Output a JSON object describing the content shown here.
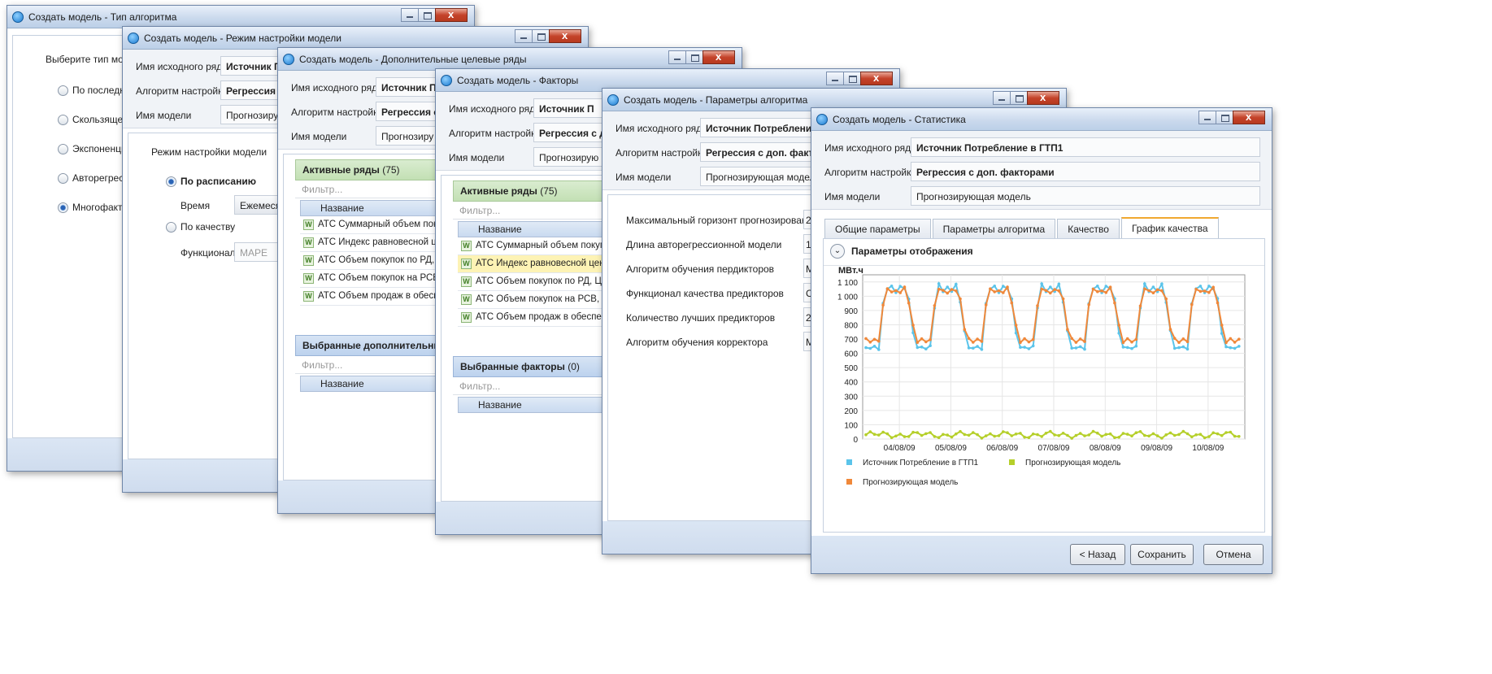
{
  "labels": {
    "source": "Имя исходного ряд",
    "algo": "Алгоритм настройк",
    "model": "Имя модели"
  },
  "values": {
    "source": "Источник Потребление в ГТП1",
    "algo": "Регрессия с доп. факторами",
    "model": "Прогнозирующая модель"
  },
  "win1": {
    "title": "Создать модель - Тип алгоритма",
    "prompt": "Выберите тип мо",
    "options": [
      "По последн",
      "Скользящее",
      "Экспоненци",
      "Авторегресс",
      "Многофакто"
    ],
    "selected": 4
  },
  "win2": {
    "title": "Создать модель - Режим настройки модели",
    "source_short": "Источник П",
    "algo_short": "Регрессия с",
    "model_short": "Прогнозиру",
    "section": "Режим настройки модели",
    "schedule": "По расписанию",
    "time_label": "Время",
    "time_value": "Ежемесяч",
    "quality": "По качеству",
    "func_label": "Функционал",
    "func_value": "MAPE"
  },
  "win3": {
    "title": "Создать модель - Дополнительные целевые ряды",
    "source_short": "Источник П",
    "algo_short": "Регрессия с",
    "model_short": "Прогнозиру",
    "active_header": "Активные ряды",
    "active_count": "(75)",
    "filter": "Фильтр...",
    "col_name": "Название",
    "rows": [
      "АТС Суммарный объем покуп",
      "АТС Индекс равновесной цен",
      "АТС Объем покупок по РД, Ц3",
      "АТС Объем покупок на РСВ, Ц3",
      "АТС Объем продаж в обеспеч"
    ],
    "selected_header": "Выбранные дополнительны"
  },
  "win4": {
    "title": "Создать модель - Факторы",
    "source_short": "Источник П",
    "algo_short": "Регрессия с д",
    "model_short": "Прогнозирую",
    "active_header": "Активные ряды",
    "active_count": "(75)",
    "filter": "Фильтр...",
    "col_name": "Название",
    "rows": [
      "АТС Суммарный объем покупки,",
      "АТС Индекс равновесной цены н",
      "АТС Объем покупок по РД, Ц3 «Е",
      "АТС Объем покупок на РСВ, Ц3 «",
      "АТС Объем продаж в обеспечен"
    ],
    "highlight": 1,
    "selected_header": "Выбранные факторы",
    "selected_count": "(0)"
  },
  "win5": {
    "title": "Создать модель - Параметры алгоритма",
    "source_short": "Источник Потреблени",
    "algo_short": "Регрессия с доп. факто",
    "model_short": "Прогнозирующая модел",
    "params": [
      "Максимальный горизонт прогнозирован",
      "Длина авторегрессионной модели",
      "Алгоритм обучения пердикторов",
      "Функционал качества предикторов",
      "Количество лучших предикторов",
      "Алгоритм обучения корректора"
    ],
    "param_vals": [
      "2",
      "1",
      "M",
      "C",
      "2",
      "M"
    ]
  },
  "win6": {
    "title": "Создать модель - Статистика",
    "tabs": [
      "Общие параметры",
      "Параметры алгоритма",
      "Качество",
      "График качества"
    ],
    "active_tab": 3,
    "section": "Параметры отображения",
    "back": "< Назад",
    "save": "Сохранить",
    "cancel": "Отмена"
  },
  "chart_data": {
    "type": "line",
    "ylabel": "МВт.ч",
    "ylim": [
      0,
      1150
    ],
    "yticks": [
      "1 100",
      "1 000",
      "900",
      "800",
      "700",
      "600",
      "500",
      "400",
      "300",
      "200",
      "100",
      "0"
    ],
    "ytick_values": [
      1100,
      1000,
      900,
      800,
      700,
      600,
      500,
      400,
      300,
      200,
      100,
      0
    ],
    "xticks": [
      "04/08/09",
      "05/08/09",
      "06/08/09",
      "07/08/09",
      "08/08/09",
      "09/08/09",
      "10/08/09"
    ],
    "days": 7.3,
    "series": [
      {
        "name": "Источник Потребление в ГТП1",
        "color": "#5bc4ea",
        "base": 640,
        "peak": 1080,
        "noise": 20
      },
      {
        "name": "Прогнозирующая модель",
        "color": "#b5cf2a",
        "base": 30,
        "peak": 40,
        "noise": 15
      },
      {
        "name": "Прогнозирующая модель",
        "color": "#f0883a",
        "base": 690,
        "peak": 1060,
        "noise": 15
      }
    ]
  }
}
